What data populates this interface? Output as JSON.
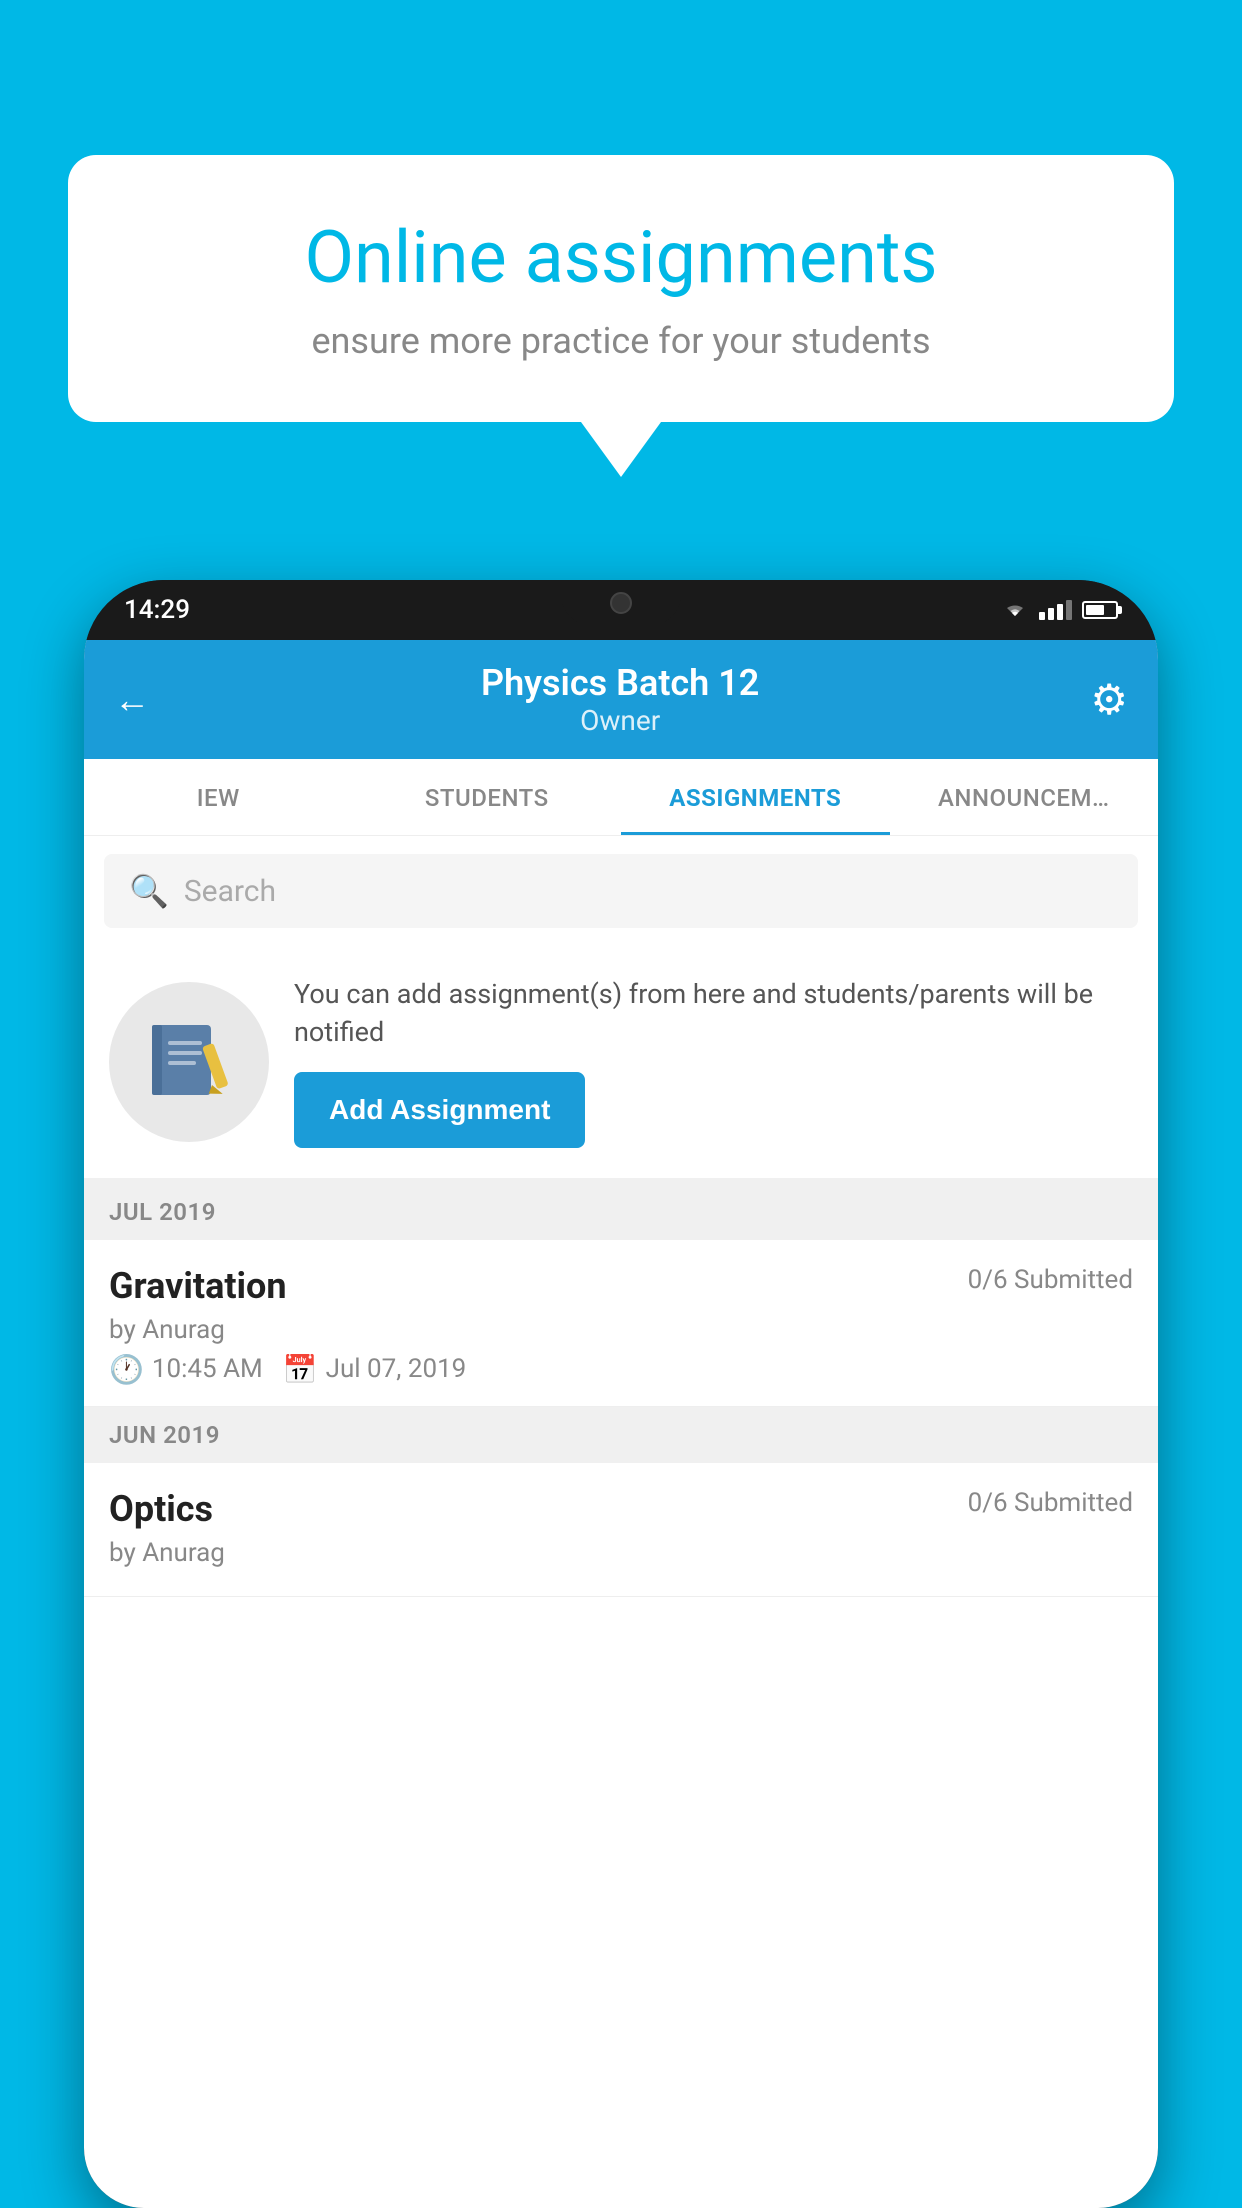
{
  "background_color": "#00b8e6",
  "speech_bubble": {
    "title": "Online assignments",
    "subtitle": "ensure more practice for your students"
  },
  "phone": {
    "status_bar": {
      "time": "14:29"
    },
    "header": {
      "title": "Physics Batch 12",
      "subtitle": "Owner",
      "back_label": "←",
      "settings_label": "⚙"
    },
    "tabs": [
      {
        "label": "IEW",
        "active": false
      },
      {
        "label": "STUDENTS",
        "active": false
      },
      {
        "label": "ASSIGNMENTS",
        "active": true
      },
      {
        "label": "ANNOUNCEM…",
        "active": false
      }
    ],
    "search": {
      "placeholder": "Search"
    },
    "promo": {
      "text": "You can add assignment(s) from here and students/parents will be notified",
      "button_label": "Add Assignment"
    },
    "sections": [
      {
        "month": "JUL 2019",
        "assignments": [
          {
            "title": "Gravitation",
            "submitted": "0/6 Submitted",
            "author": "by Anurag",
            "time": "10:45 AM",
            "date": "Jul 07, 2019"
          }
        ]
      },
      {
        "month": "JUN 2019",
        "assignments": [
          {
            "title": "Optics",
            "submitted": "0/6 Submitted",
            "author": "by Anurag",
            "time": "",
            "date": ""
          }
        ]
      }
    ]
  }
}
